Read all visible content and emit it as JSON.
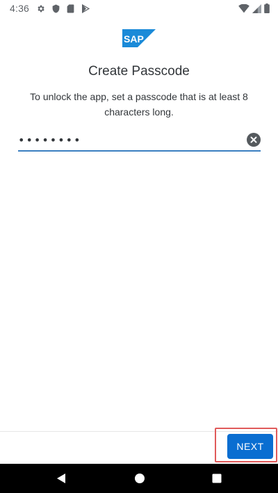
{
  "status_bar": {
    "time": "4:36",
    "icons_left": [
      "gear-icon",
      "shield-icon",
      "sd-card-icon",
      "play-store-icon"
    ],
    "icons_right": [
      "wifi-icon",
      "cell-signal-icon",
      "battery-icon"
    ]
  },
  "logo": {
    "text": "SAP",
    "color": "#1a8ad8"
  },
  "title": "Create Passcode",
  "description": "To unlock the app, set a passcode that is at least 8 characters long.",
  "passcode_field": {
    "value": "12345678",
    "clear_icon": "clear-icon"
  },
  "action_bar": {
    "next_label": "NEXT"
  },
  "nav_bar": {
    "icons": [
      "back-icon",
      "home-icon",
      "recents-icon"
    ]
  },
  "colors": {
    "accent": "#0a6ed1",
    "field_underline": "#3a7fc1",
    "highlight": "#e05a5a",
    "text": "#32363a"
  }
}
